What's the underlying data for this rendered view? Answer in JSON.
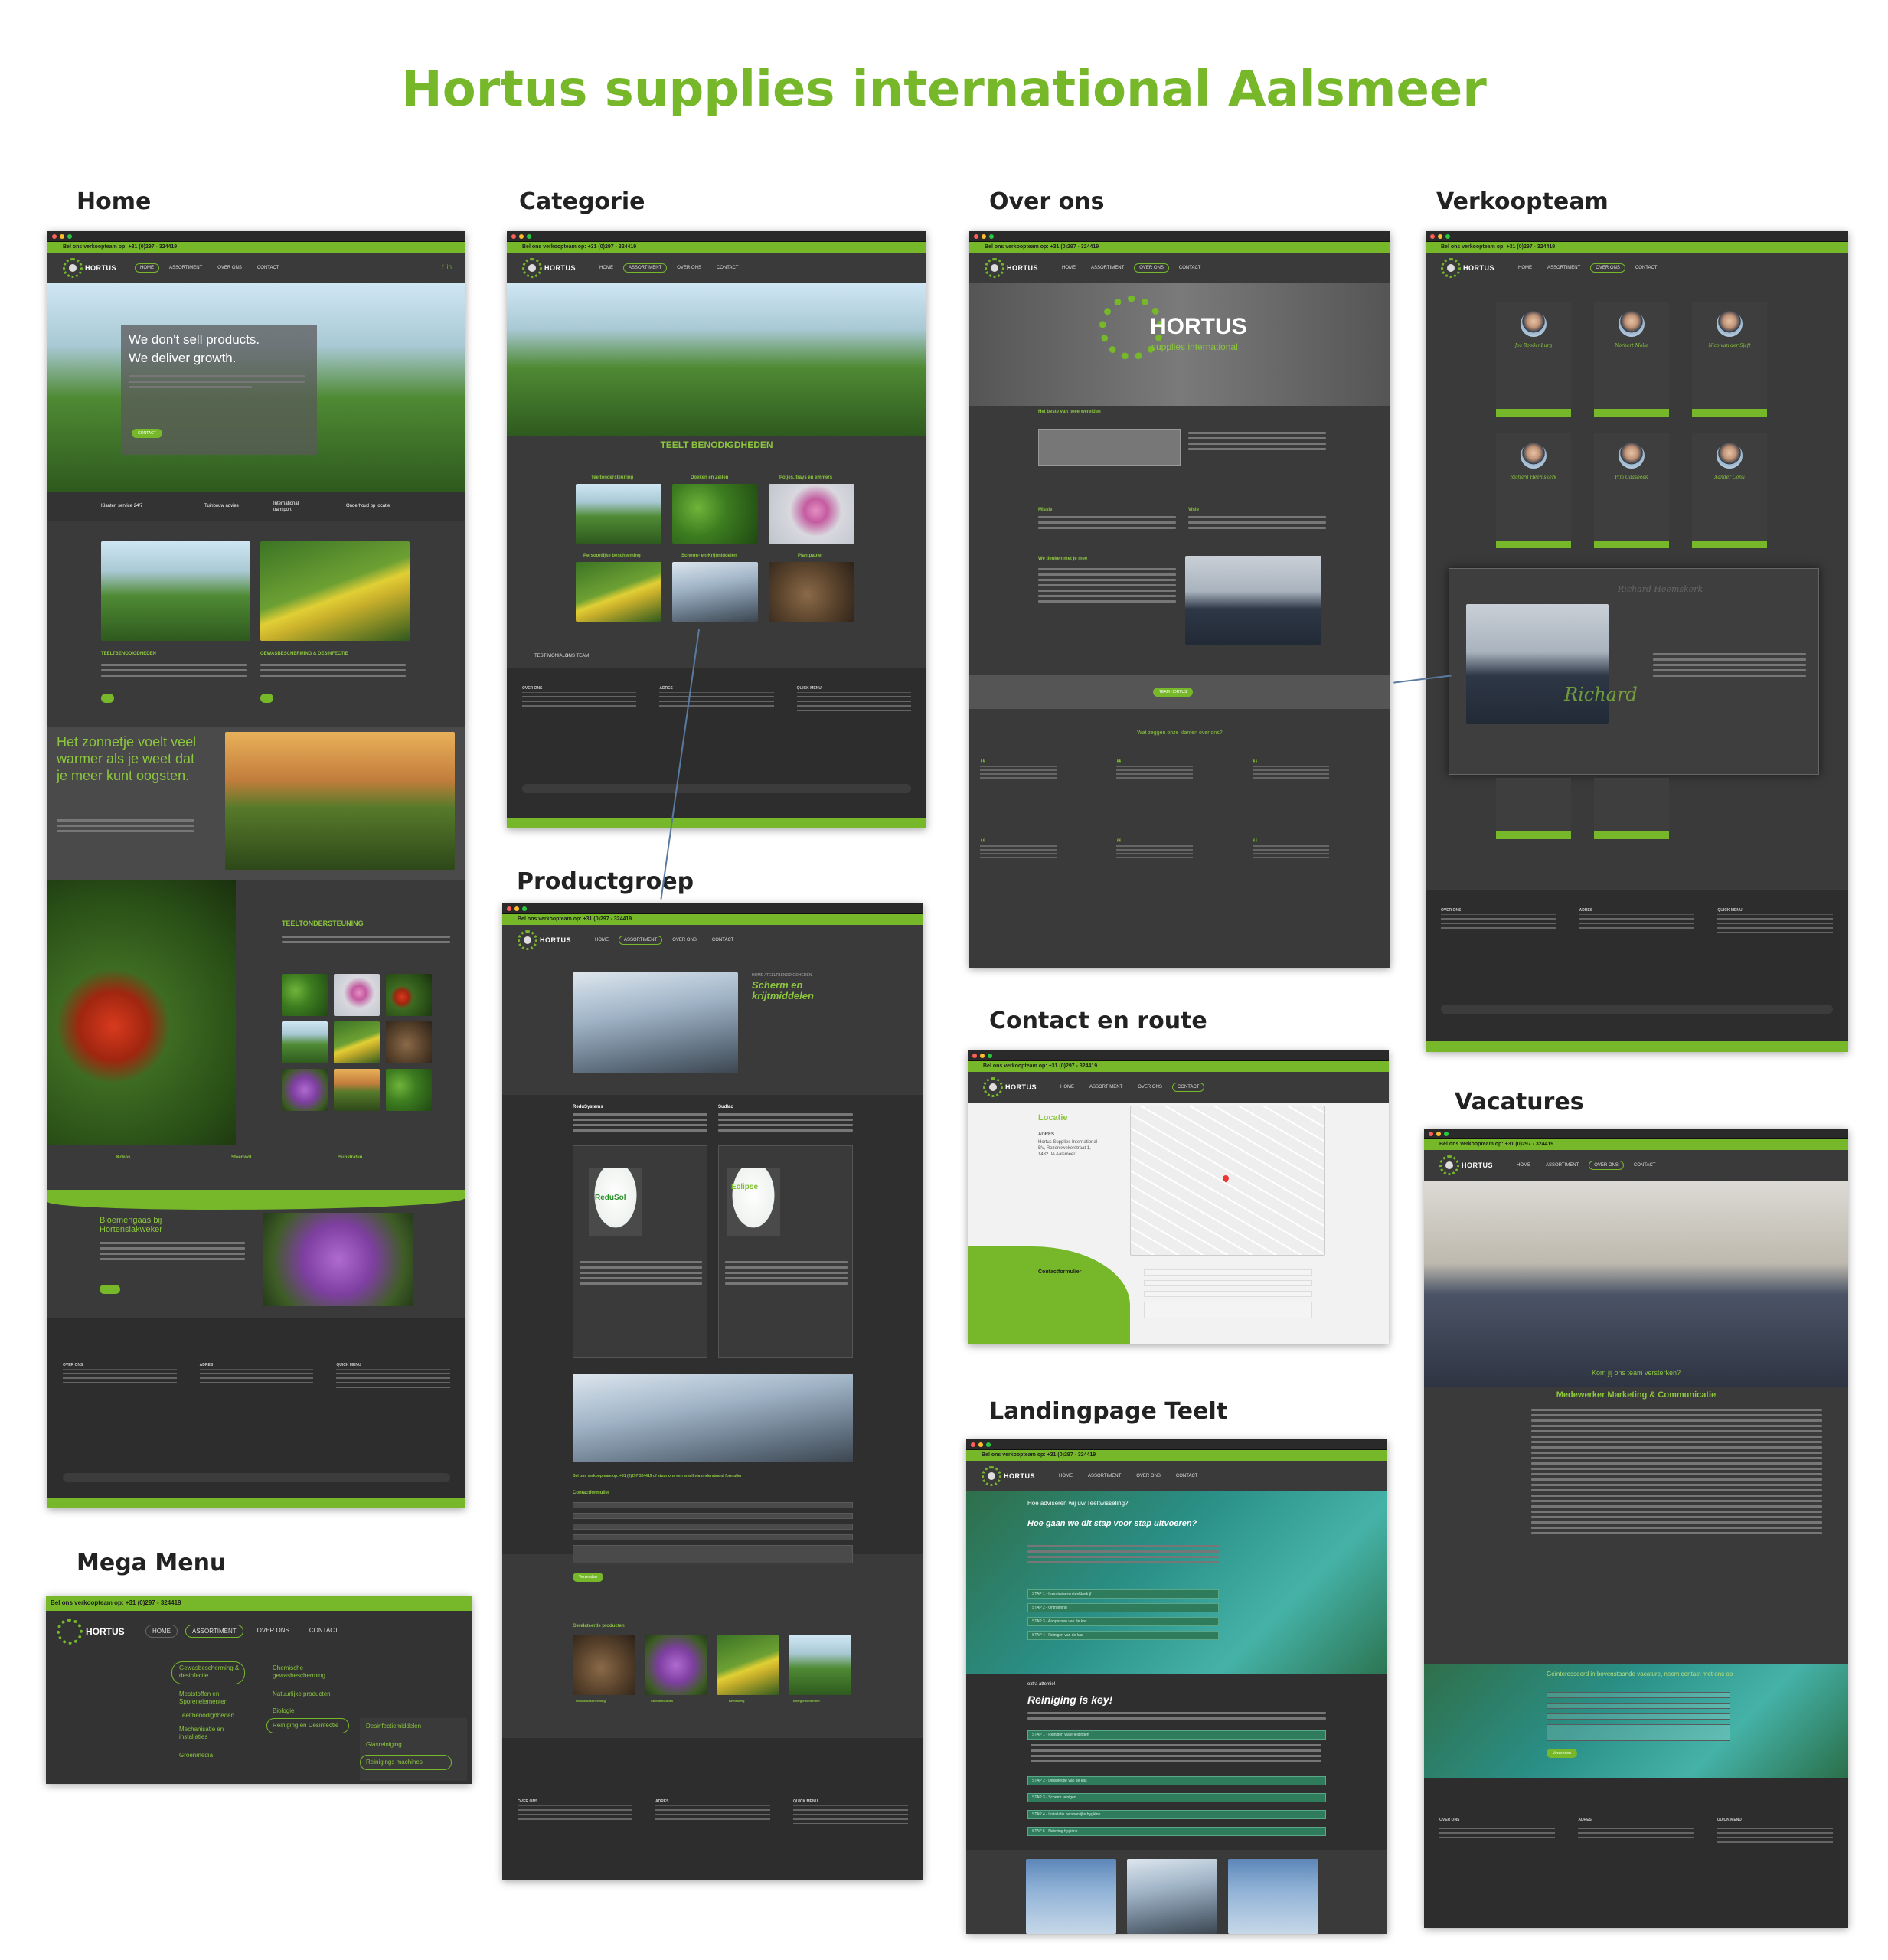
{
  "title": "Hortus supplies international Aalsmeer",
  "labels": {
    "home": "Home",
    "categorie": "Categorie",
    "over_ons": "Over ons",
    "verkoopteam": "Verkoopteam",
    "productgroep": "Productgroep",
    "contact": "Contact en route",
    "vacatures": "Vacatures",
    "landing": "Landingpage Teelt",
    "mega": "Mega Menu"
  },
  "site": {
    "topbar": "Bel ons verkoopteam op: +31 (0)297 - 324419",
    "logo": "HORTUS",
    "nav": [
      "HOME",
      "ASSORTIMENT",
      "OVER ONS",
      "CONTACT"
    ]
  },
  "home": {
    "hero_line1": "We don't sell products.",
    "hero_line2": "We deliver growth.",
    "hero_btn": "CONTACT",
    "usp": [
      "Klanten service 24/7",
      "Tuinbouw advies",
      "International transport",
      "Onderhoud op locatie"
    ],
    "cat1": "TEELTBENODIGDHEDEN",
    "cat2": "GEWASBESCHERMING & DESINFECTIE",
    "sun_text": "Het zonnetje voelt veel warmer als je weet dat je meer kunt oogsten.",
    "teelt_title": "TEELTONDERSTEUNING",
    "subs": [
      "Kokos",
      "Steenwol",
      "Substraten"
    ],
    "bloem_title": "Bloemengaas bij Hortensiakweker"
  },
  "categorie": {
    "heading": "TEELT BENODIGDHEDEN",
    "tiles": [
      "Teeltondersteuning",
      "Doeken en Zeilen",
      "Potjes, trays en emmers",
      "Persoonlijke bescherming",
      "Scherm- en Krijtmiddelen",
      "Plantpapier"
    ],
    "tabs": [
      "TESTIMONIALS",
      "ONS TEAM"
    ]
  },
  "over_ons": {
    "logo_big": "HORTUS",
    "logo_sub": "supplies international",
    "best": "Het beste van twee werelden",
    "missie": "Missie",
    "visie": "Visie",
    "denken": "We denken met je mee",
    "btn": "TEAM HORTUS",
    "klanten": "Wat zeggen onze klanten over ons?"
  },
  "verkoopteam": {
    "names": [
      "Jos Roodenburg",
      "Norbert Molle",
      "Nico van der Sjeft",
      "Richard Heemskerk",
      "Pim Gaasbeek",
      "Xander Conu"
    ],
    "btn": "MAAK EEN AFSPRAAK",
    "popup_name": "Richard Heemskerk",
    "signature": "Richard"
  },
  "productgroep": {
    "breadcrumb": "HOME / TEELTBENODIGDHEDEN",
    "title": "Scherm en krijtmiddelen",
    "left_product": "ReduSystems",
    "right_product": "Sudlac",
    "bucket1": "ReduSol",
    "bucket2": "Eclipse",
    "cta": "Bel ons verkoopteam op: +31 (0)297 324419 of stuur ons een email via onderstaand formulier",
    "form_title": "Contactformulier",
    "fields": [
      "Naam",
      "Bedrijf",
      "E-mailadres",
      "Telefoonnummer",
      "Opmerking"
    ],
    "send": "Verzenden",
    "related": "Gerelateerde producten",
    "related_items": [
      "Gewas bescherming",
      "Steenwolcubes",
      "Bemesting",
      "Energie schermen"
    ]
  },
  "contact": {
    "locatie": "Locatie",
    "adres_label": "ADRES",
    "adres": "Hortus Supplies International BV, Rozenkwekerstraat 1, 1432 JA Aalsmeer",
    "formulier": "Contactformulier"
  },
  "vacatures": {
    "hero_text": "Kom jij ons team versterken?",
    "job_title": "Medewerker Marketing & Communicatie",
    "apply_title": "Geïnteresseerd in bovenstaande vacature, neem contact met ons op",
    "send": "Verzenden"
  },
  "landing": {
    "intro": "Hoe adviseren wij uw Teeltwisseling?",
    "question": "Hoe gaan we dit stap voor stap uitvoeren?",
    "steps_top": [
      "STAP 1 - Inventariseren teeltbedrijf",
      "STAP 2 - Ontruiming",
      "STAP 3 - Aanpassen van de kas",
      "STAP 4 - Reinigen van de kas"
    ],
    "extra": "extra attentie!",
    "key": "Reiniging is key!",
    "steps_bottom": [
      "STAP 1 - Reinigen waterleidingen",
      "STAP 2 - Desinfectie van de kas",
      "STAP 3 - Scherm reinigen",
      "STAP 4 - Installatie persoonlijke hygiëne",
      "STAP 5 - Naleving hygiëne"
    ]
  },
  "mega": {
    "topbar": "Bel ons verkoopteam op: +31 (0)297 - 324419",
    "logo": "HORTUS",
    "nav": [
      "HOME",
      "ASSORTIMENT",
      "OVER ONS",
      "CONTACT"
    ],
    "col1": [
      "Gewasbescherming & desinfectie",
      "Meststoffen en Sporenelementen",
      "Teeltbenodigdheden",
      "Mechanisatie en installaties",
      "Groenmedia"
    ],
    "col2": [
      "Chemische gewasbescherming",
      "Natuurlijke producten",
      "Biologie",
      "Reiniging en Desinfectie"
    ],
    "col3": [
      "Desinfectiemiddelen",
      "Glasreiniging",
      "Reinigings machines"
    ]
  },
  "colors": {
    "brand_green": "#76b82a",
    "dark": "#3a3a3a",
    "teal": "#2a8f86"
  }
}
